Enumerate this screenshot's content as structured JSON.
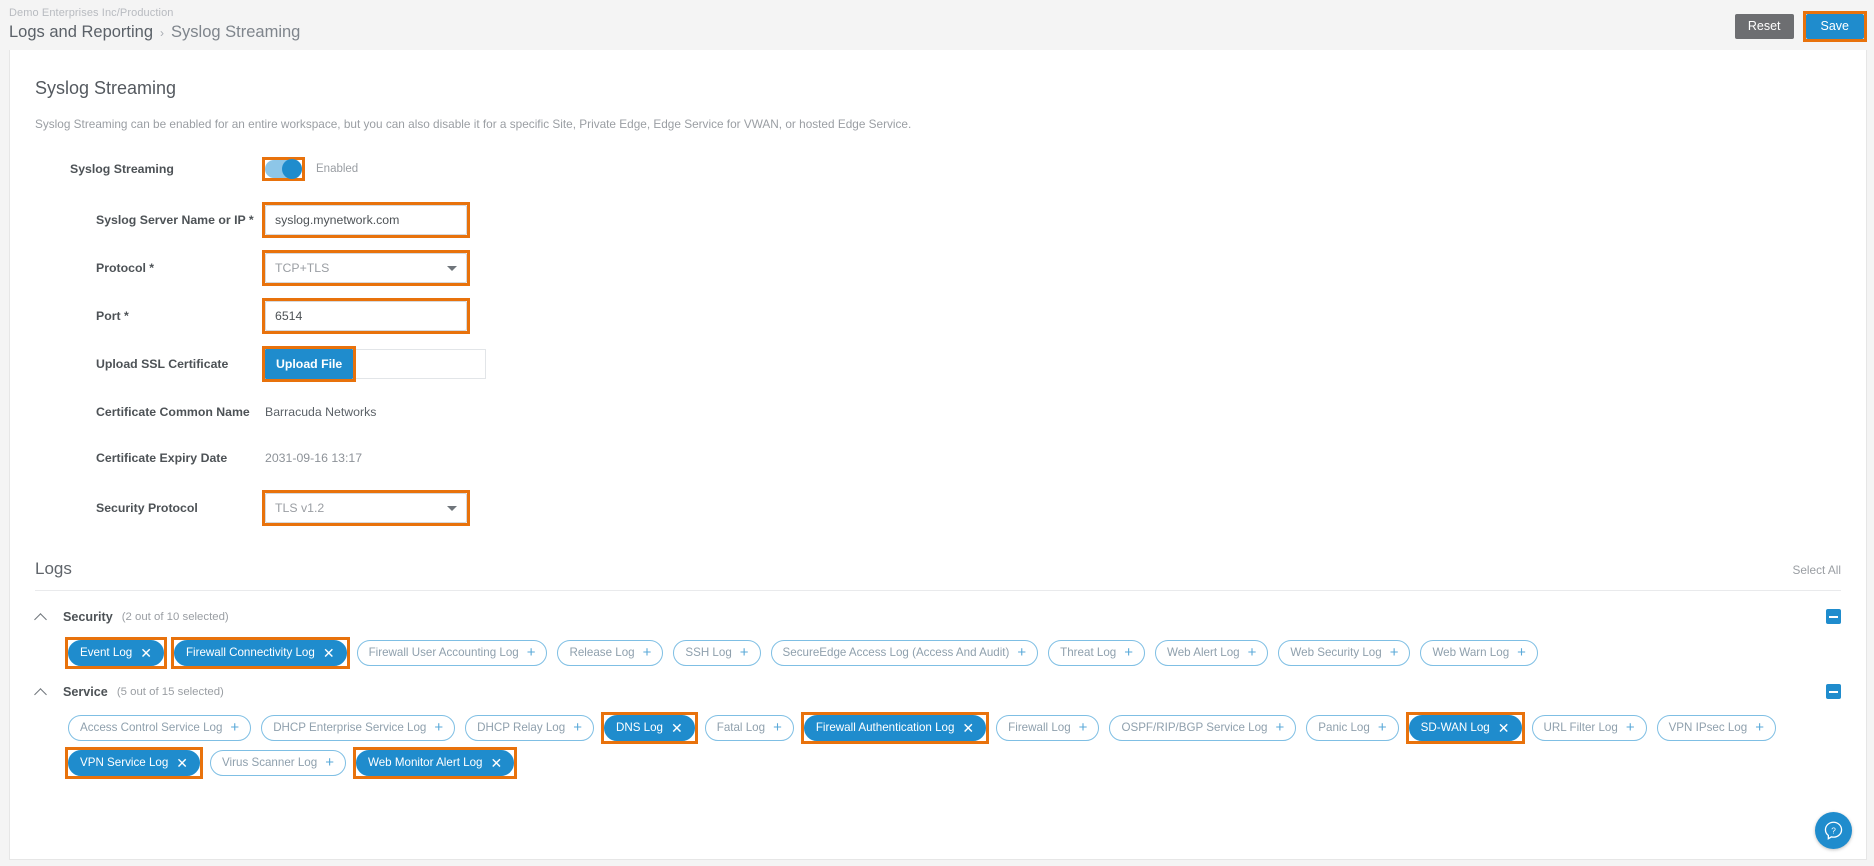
{
  "topbar": {
    "tenant": "Demo Enterprises Inc/Production",
    "breadcrumb_parent": "Logs and Reporting",
    "breadcrumb_separator": "›",
    "breadcrumb_current": "Syslog Streaming",
    "reset_label": "Reset",
    "save_label": "Save"
  },
  "page": {
    "title": "Syslog Streaming",
    "description": "Syslog Streaming can be enabled for an entire workspace, but you can also disable it for a specific Site, Private Edge, Edge Service for VWAN, or hosted Edge Service."
  },
  "form": {
    "syslog_streaming_label": "Syslog Streaming",
    "syslog_streaming_state": "Enabled",
    "server_label": "Syslog Server Name or IP *",
    "server_value": "syslog.mynetwork.com",
    "server_placeholder": "Syslog Server Name or IP",
    "protocol_label": "Protocol *",
    "protocol_value": "TCP+TLS",
    "port_label": "Port *",
    "port_value": "6514",
    "port_placeholder": "Port",
    "upload_label": "Upload SSL Certificate",
    "upload_button": "Upload File",
    "upload_file_value": "",
    "cert_cn_label": "Certificate Common Name",
    "cert_cn_value": "Barracuda Networks",
    "cert_expiry_label": "Certificate Expiry Date",
    "cert_expiry_value": "2031-09-16 13:17",
    "security_protocol_label": "Security Protocol",
    "security_protocol_value": "TLS v1.2"
  },
  "logs": {
    "title": "Logs",
    "select_all": "Select All",
    "groups": [
      {
        "name": "Security",
        "count": "(2 out of 10 selected)",
        "chips": [
          {
            "label": "Event Log",
            "selected": true,
            "highlighted": true
          },
          {
            "label": "Firewall Connectivity Log",
            "selected": true,
            "highlighted": true
          },
          {
            "label": "Firewall User Accounting Log",
            "selected": false,
            "highlighted": false
          },
          {
            "label": "Release Log",
            "selected": false,
            "highlighted": false
          },
          {
            "label": "SSH Log",
            "selected": false,
            "highlighted": false
          },
          {
            "label": "SecureEdge Access Log (Access And Audit)",
            "selected": false,
            "highlighted": false
          },
          {
            "label": "Threat Log",
            "selected": false,
            "highlighted": false
          },
          {
            "label": "Web Alert Log",
            "selected": false,
            "highlighted": false
          },
          {
            "label": "Web Security Log",
            "selected": false,
            "highlighted": false
          },
          {
            "label": "Web Warn Log",
            "selected": false,
            "highlighted": false
          }
        ]
      },
      {
        "name": "Service",
        "count": "(5 out of 15 selected)",
        "chips": [
          {
            "label": "Access Control Service Log",
            "selected": false,
            "highlighted": false
          },
          {
            "label": "DHCP Enterprise Service Log",
            "selected": false,
            "highlighted": false
          },
          {
            "label": "DHCP Relay Log",
            "selected": false,
            "highlighted": false
          },
          {
            "label": "DNS Log",
            "selected": true,
            "highlighted": true
          },
          {
            "label": "Fatal Log",
            "selected": false,
            "highlighted": false
          },
          {
            "label": "Firewall Authentication Log",
            "selected": true,
            "highlighted": true
          },
          {
            "label": "Firewall Log",
            "selected": false,
            "highlighted": false
          },
          {
            "label": "OSPF/RIP/BGP Service Log",
            "selected": false,
            "highlighted": false
          },
          {
            "label": "Panic Log",
            "selected": false,
            "highlighted": false
          },
          {
            "label": "SD-WAN Log",
            "selected": true,
            "highlighted": true
          },
          {
            "label": "URL Filter Log",
            "selected": false,
            "highlighted": false
          },
          {
            "label": "VPN IPsec Log",
            "selected": false,
            "highlighted": false
          },
          {
            "label": "VPN Service Log",
            "selected": true,
            "highlighted": true
          },
          {
            "label": "Virus Scanner Log",
            "selected": false,
            "highlighted": false
          },
          {
            "label": "Web Monitor Alert Log",
            "selected": true,
            "highlighted": true
          }
        ]
      }
    ],
    "chip_add_glyph": "+",
    "chip_remove_glyph": "✕"
  },
  "help": {
    "icon": "question-mark-help-icon",
    "glyph": "?"
  },
  "colors": {
    "accent_blue": "#1f8ccd",
    "highlight_orange": "#e8720c",
    "reset_gray": "#6d6e71",
    "chip_border": "#7fbfe4"
  }
}
